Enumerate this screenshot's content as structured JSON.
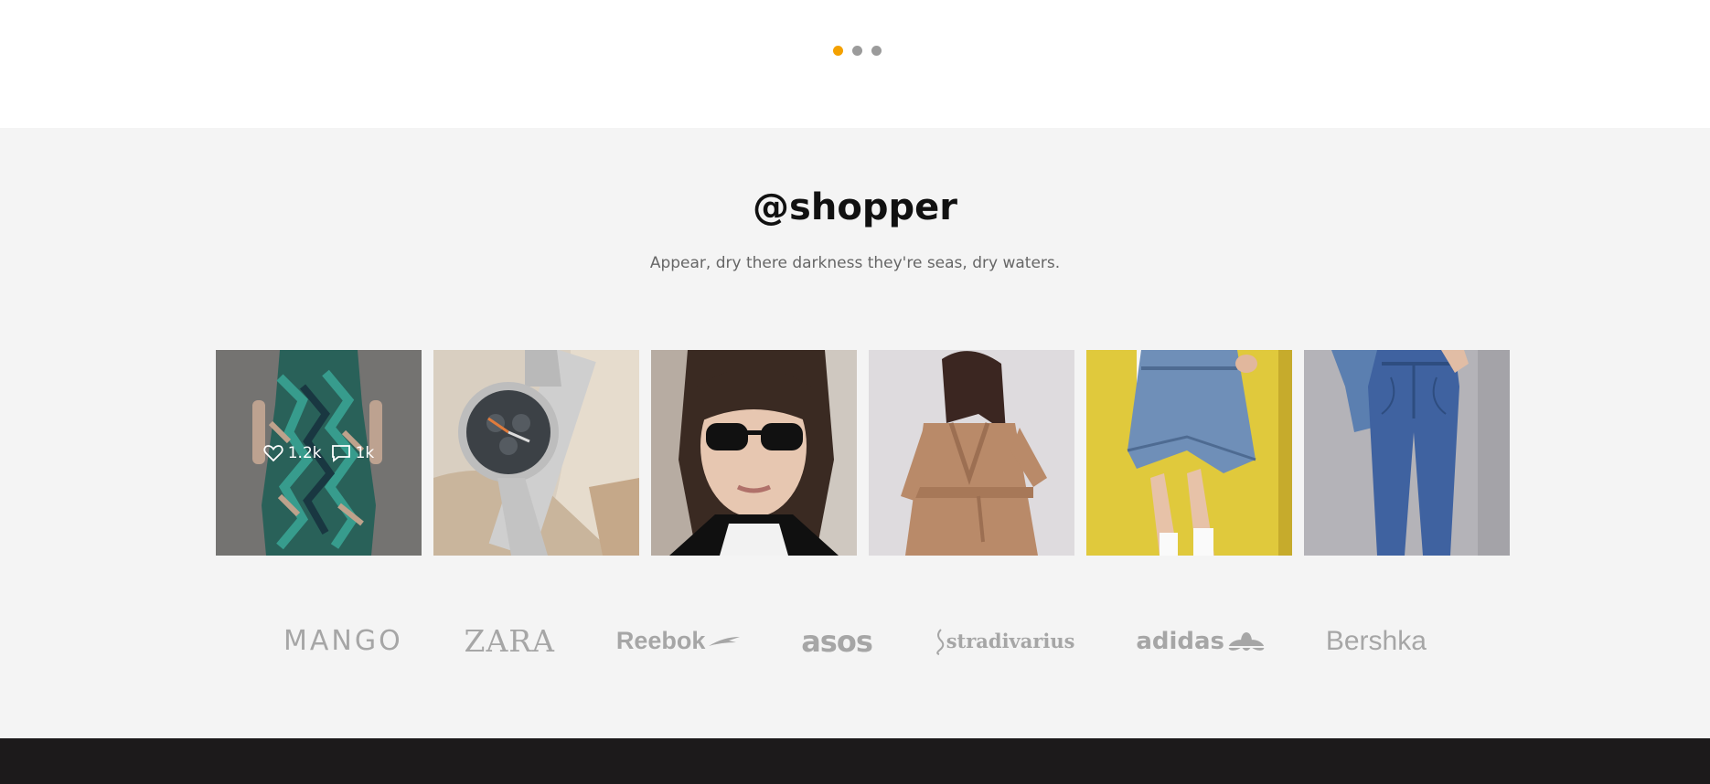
{
  "slider": {
    "dots": [
      {
        "label": "slide-1",
        "active": true
      },
      {
        "label": "slide-2",
        "active": false
      },
      {
        "label": "slide-3",
        "active": false
      }
    ],
    "active_color": "#f4a100",
    "inactive_color": "#9b9b9b"
  },
  "instagram": {
    "handle": "@shopper",
    "subtitle": "Appear, dry there darkness they're seas, dry waters.",
    "overlay": {
      "likes": "1.2k",
      "comments": "1k",
      "like_icon": "heart-icon",
      "comment_icon": "comment-icon"
    },
    "tiles": [
      "green-patterned-dress",
      "wristwatch",
      "woman-sunglasses",
      "camel-coat",
      "denim-skirt",
      "blue-jeans"
    ]
  },
  "brands": [
    "MANGO",
    "ZARA",
    "Reebok",
    "asos",
    "stradivarius",
    "adidas",
    "Bershka"
  ],
  "colors": {
    "section_bg": "#f4f4f4",
    "footer_bg": "#1c1a1b",
    "brand_gray": "#a6a6a6"
  }
}
